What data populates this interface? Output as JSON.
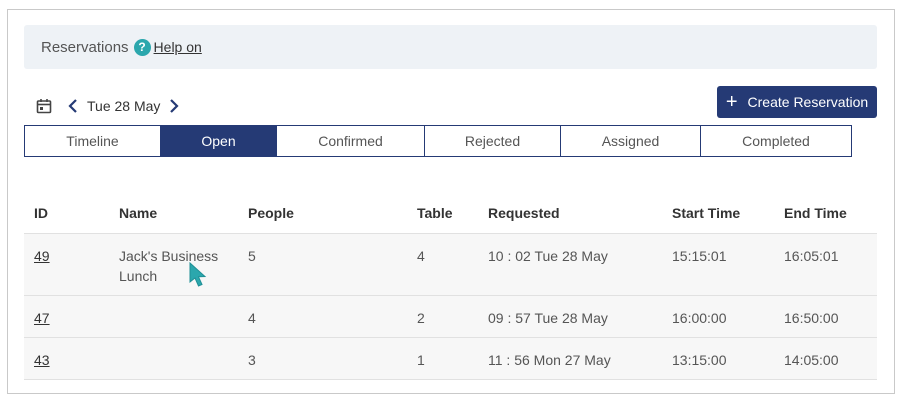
{
  "header": {
    "title": "Reservations",
    "help_label": "Help on"
  },
  "datebar": {
    "date": "Tue 28 May"
  },
  "create_button": {
    "label": "Create Reservation"
  },
  "tabs": [
    {
      "label": "Timeline",
      "active": false
    },
    {
      "label": "Open",
      "active": true
    },
    {
      "label": "Confirmed",
      "active": false
    },
    {
      "label": "Rejected",
      "active": false
    },
    {
      "label": "Assigned",
      "active": false
    },
    {
      "label": "Completed",
      "active": false
    }
  ],
  "table": {
    "columns": [
      "ID",
      "Name",
      "People",
      "Table",
      "Requested",
      "Start Time",
      "End Time"
    ],
    "rows": [
      {
        "id": "49",
        "name_line1": "Jack's Business",
        "name_line2": "Lunch",
        "people": "5",
        "table": "4",
        "requested": "10 : 02 Tue 28 May",
        "start": "15:15:01",
        "end": "16:05:01"
      },
      {
        "id": "47",
        "name_line1": "",
        "name_line2": "",
        "people": "4",
        "table": "2",
        "requested": "09 : 57 Tue 28 May",
        "start": "16:00:00",
        "end": "16:50:00"
      },
      {
        "id": "43",
        "name_line1": "",
        "name_line2": "",
        "people": "3",
        "table": "1",
        "requested": "11 : 56 Mon 27 May",
        "start": "13:15:00",
        "end": "14:05:00"
      }
    ]
  },
  "colors": {
    "accent": "#253a75",
    "help": "#2ba7ad",
    "cursor": "#2ba7ad"
  }
}
